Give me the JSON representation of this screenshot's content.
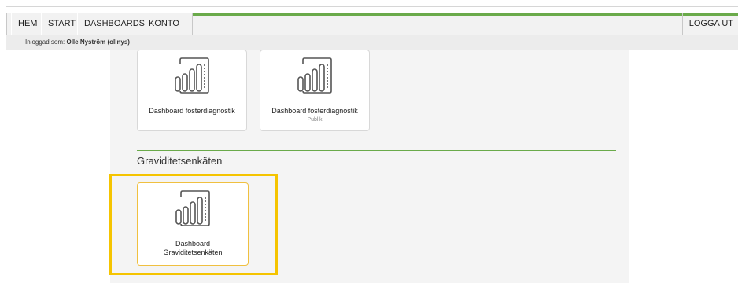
{
  "nav": {
    "items": [
      "HEM",
      "START",
      "DASHBOARDS",
      "KONTO"
    ],
    "logout": "LOGGA UT"
  },
  "login": {
    "prefix": "Inloggad som: ",
    "user": "Olle Nyström (ollnys)"
  },
  "cards_top": [
    {
      "title": "Dashboard fosterdiagnostik",
      "subtitle": ""
    },
    {
      "title": "Dashboard fosterdiagnostik",
      "subtitle": "Publik"
    }
  ],
  "section": {
    "title": "Graviditetsenkäten",
    "cards": [
      {
        "title_line1": "Dashboard",
        "title_line2": "Graviditetsenkäten"
      }
    ]
  },
  "colors": {
    "accent": "#6aaa4a",
    "highlight": "#f5c400"
  },
  "icons": {
    "dashboard": "power-bi-dashboard-icon"
  }
}
